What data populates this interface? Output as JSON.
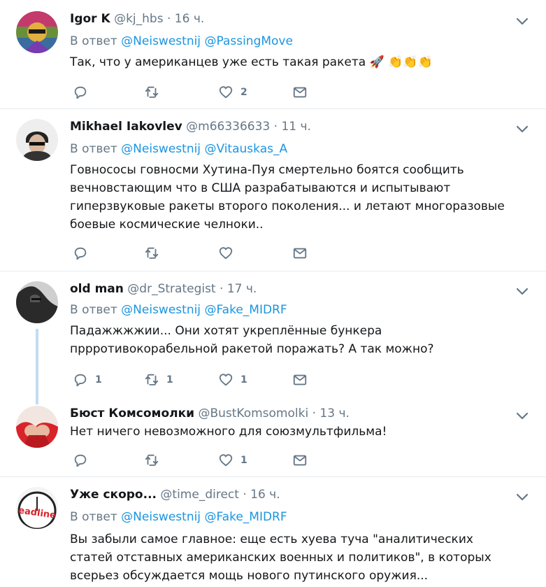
{
  "labels": {
    "reply_prefix": "В ответ"
  },
  "tweets": [
    {
      "name": "Igor K",
      "handle": "@kj_hbs",
      "sep": "·",
      "time": "16 ч.",
      "reply_to": [
        "@Neiswestnij",
        "@PassingMove"
      ],
      "text": "Так, что у американцев уже есть такая ракета 🚀 👏👏👏",
      "counts": {
        "reply": "",
        "retweet": "",
        "like": "2"
      }
    },
    {
      "name": "Mikhael Iakovlev",
      "handle": "@m66336633",
      "sep": "·",
      "time": "11 ч.",
      "reply_to": [
        "@Neiswestnij",
        "@Vitauskas_A"
      ],
      "text": "Говнососы говносми Хутина-Пуя смертельно боятся сообщить вечновстающим что в США разрабатываются и испытывают гиперзвуковые ракеты второго поколения... и летают многоразовые боевые  космические челноки..",
      "counts": {
        "reply": "",
        "retweet": "",
        "like": ""
      }
    },
    {
      "name": "old man",
      "handle": "@dr_Strategist",
      "sep": "·",
      "time": "17 ч.",
      "reply_to": [
        "@Neiswestnij",
        "@Fake_MIDRF"
      ],
      "text": "Падажжжжии... Они хотят укреплённые бункера пррротивокорабельной ракетой поражать? А так можно?",
      "counts": {
        "reply": "1",
        "retweet": "1",
        "like": "1"
      }
    },
    {
      "name": "Бюст Комсомолки",
      "handle": "@BustKomsomolki",
      "sep": "·",
      "time": "13 ч.",
      "reply_to": [],
      "text": "Нет ничего невозможного для союзмультфильма!",
      "counts": {
        "reply": "",
        "retweet": "",
        "like": "1"
      }
    },
    {
      "name": "Уже скоро...",
      "handle": "@time_direct",
      "sep": "·",
      "time": "16 ч.",
      "reply_to": [
        "@Neiswestnij",
        "@Fake_MIDRF"
      ],
      "text": "Вы забыли самое главное: еще есть хуева туча \"аналитических статей отставных американских военных и политиков\", в которых всерьез обсуждается мощь нового путинского оружия...",
      "counts": {
        "reply": "",
        "retweet": "",
        "like": ""
      }
    }
  ],
  "avatar_5_text": "eadline",
  "icons": {
    "reply": "reply-icon",
    "retweet": "retweet-icon",
    "like": "heart-icon",
    "dm": "envelope-icon",
    "caret": "chevron-down-icon"
  },
  "colors": {
    "text": "#14171a",
    "muted": "#657786",
    "link": "#1b95e0",
    "divider": "#e6ecf0",
    "thread": "#c4dcf0"
  }
}
